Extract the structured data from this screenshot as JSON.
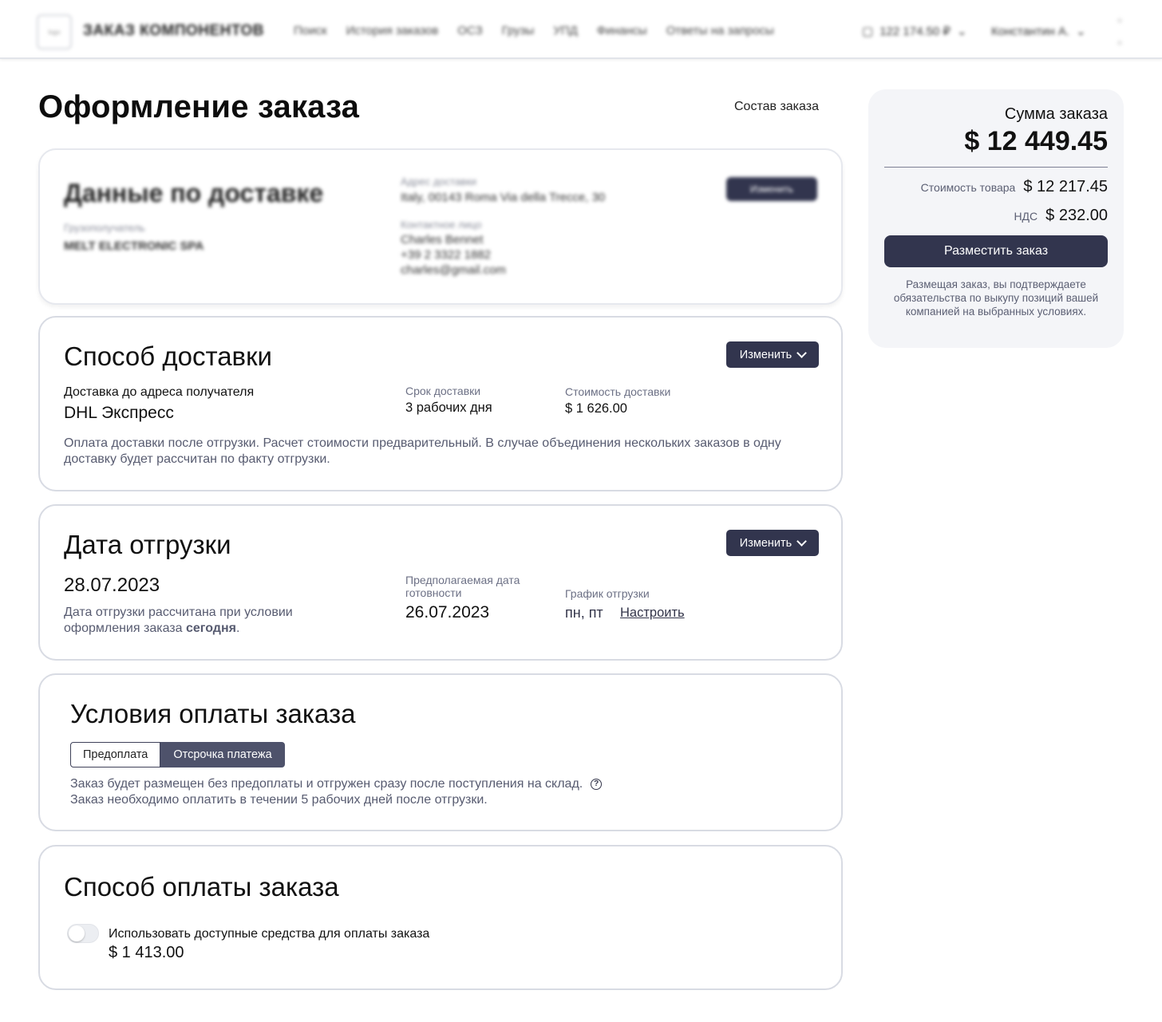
{
  "header": {
    "logo_text": "logo",
    "brand": "ЗАКАЗ КОМПОНЕНТОВ",
    "nav": [
      "Поиск",
      "История заказов",
      "ОСЗ",
      "Грузы",
      "УПД",
      "Финансы",
      "Ответы на запросы"
    ],
    "balance": "122 174.50 ₽",
    "user": "Константин А."
  },
  "page": {
    "title": "Оформление заказа",
    "order_composition_link": "Состав заказа"
  },
  "delivery_data": {
    "title": "Данные по доставке",
    "recipient_label": "Грузополучатель",
    "recipient_value": "MELT ELECTRONIC SPA",
    "address_label": "Адрес доставки",
    "address_value": "Italy, 00143 Roma Via della Trecce, 30",
    "contact_label": "Контактное лицо",
    "contact_name": "Charles Bennet",
    "contact_phone": "+39 2 3322 1882",
    "contact_email": "charles@gmail.com",
    "change_label": "Изменить"
  },
  "delivery_method": {
    "title": "Способ доставки",
    "change_label": "Изменить",
    "type_label": "Доставка до адреса получателя",
    "carrier": "DHL Экспресс",
    "term_label": "Срок доставки",
    "term_value": "3 рабочих дня",
    "cost_label": "Стоимость доставки",
    "cost_value": "$ 1 626.00",
    "note": "Оплата доставки после отгрузки. Расчет стоимости предварительный. В случае объединения нескольких заказов в одну доставку будет рассчитан по факту отгрузки."
  },
  "shipment_date": {
    "title": "Дата отгрузки",
    "change_label": "Изменить",
    "date": "28.07.2023",
    "note_prefix": "Дата отгрузки рассчитана при условии оформления заказа ",
    "note_bold": "сегодня",
    "note_suffix": ".",
    "ready_label": "Предполагаемая дата готовности",
    "ready_value": "26.07.2023",
    "schedule_label": "График отгрузки",
    "schedule_value": "пн, пт",
    "schedule_link": "Настроить"
  },
  "payment_terms": {
    "title": "Условия оплаты заказа",
    "options": [
      "Предоплата",
      "Отсрочка платежа"
    ],
    "selected": "Отсрочка платежа",
    "line1": "Заказ будет размещен без предоплаты и отгружен сразу после поступления на склад.",
    "line2": "Заказ необходимо оплатить в течении 5 рабочих дней после отгрузки."
  },
  "payment_method": {
    "title": "Способ оплаты заказа",
    "toggle_label": "Использовать доступные средства для оплаты заказа",
    "toggle_on": false,
    "available_amount": "$ 1 413.00"
  },
  "summary": {
    "label": "Сумма заказа",
    "total": "$ 12 449.45",
    "goods_label": "Стоимость товара",
    "goods_value": "$ 12 217.45",
    "vat_label": "НДС",
    "vat_value": "$ 232.00",
    "place_order_label": "Разместить заказ",
    "note": "Размещая заказ, вы подтверждаете обязательства по выкупу позиций вашей компанией на выбранных условиях."
  },
  "colors": {
    "primary_dark": "#32354e",
    "segment_active": "#4e526b",
    "card_border": "#d8dbe3",
    "summary_bg": "#f4f5f8"
  }
}
